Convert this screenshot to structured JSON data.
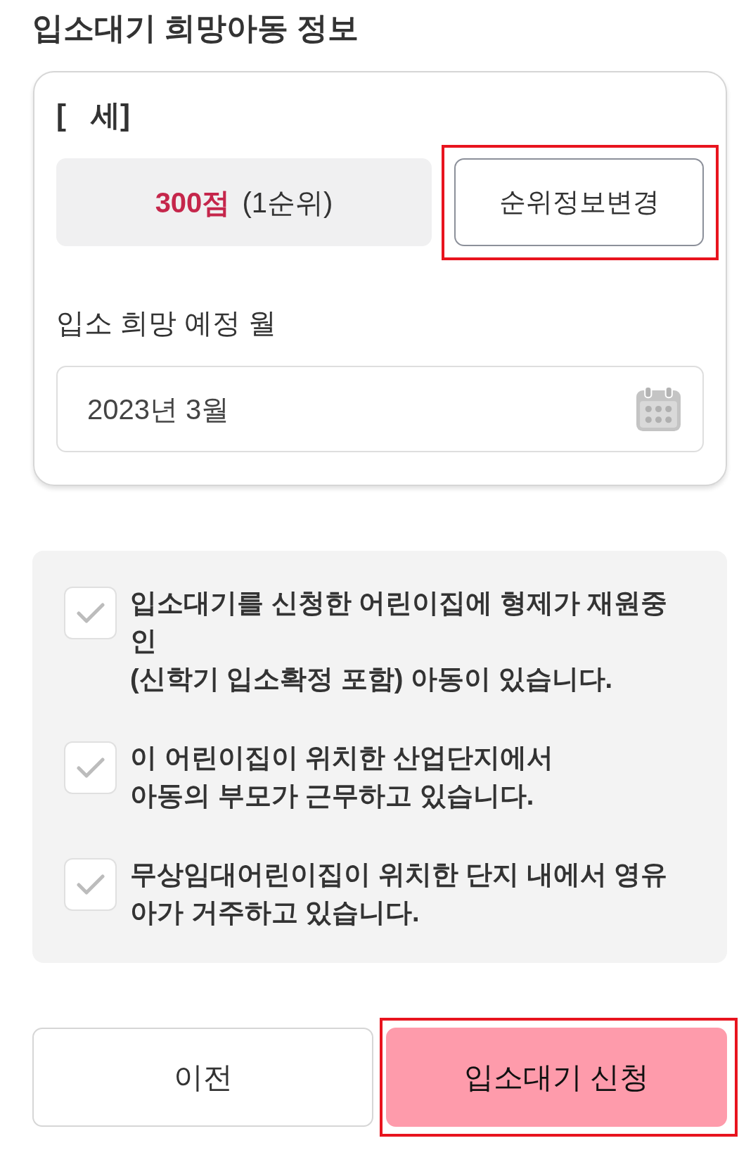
{
  "section_title": "입소대기 희망아동 정보",
  "child_card": {
    "name_line": "[   세]",
    "score": "**300점** (1순위)",
    "rank_button": {
      "label": "순위정보변경",
      "highlighted": true
    },
    "month_label": "입소 희망 예정 월",
    "month_field": {
      "value": "2023년 3월"
    }
  },
  "conditions": [
    {
      "text": "입소대기를 신청한 어린이집에 형제가 재원중\n인\n(신학기 입소확정 포함) 아동이 있습니다.",
      "checked": false
    },
    {
      "text": "이 어린이집이 위치한 산업단지에서\n아동의 부모가 근무하고 있습니다.",
      "checked": false
    },
    {
      "text": "무상임대어린이집이 위치한 단지 내에서 영유\n아가 거주하고 있습니다.",
      "checked": false
    }
  ],
  "buttons": [
    {
      "label": "이전",
      "kind": "secondary",
      "highlighted": false
    },
    {
      "label": "입소대기 신청",
      "kind": "primary",
      "highlighted": true
    }
  ]
}
